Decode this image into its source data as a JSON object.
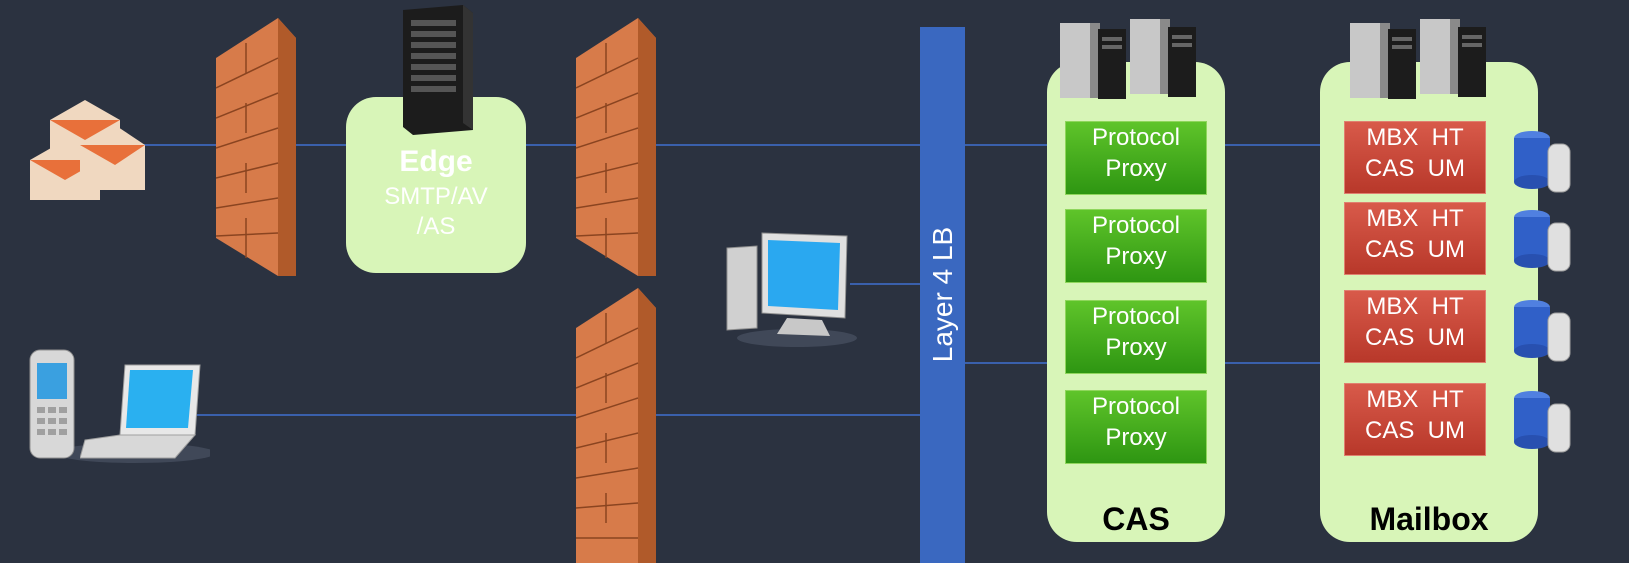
{
  "colors": {
    "background": "#2b3240",
    "panel": "#d8f5b8",
    "proxy": "#3fab1c",
    "mailbox_role": "#c8453a",
    "load_balancer": "#3a68c0",
    "connector": "#3f6fd0",
    "firewall": "#d77b4a"
  },
  "edge": {
    "title": "Edge",
    "line1": "SMTP/AV",
    "line2": "/AS"
  },
  "load_balancer": {
    "label": "Layer 4 LB"
  },
  "cas": {
    "title": "CAS",
    "proxies": [
      {
        "line1": "Protocol",
        "line2": "Proxy"
      },
      {
        "line1": "Protocol",
        "line2": "Proxy"
      },
      {
        "line1": "Protocol",
        "line2": "Proxy"
      },
      {
        "line1": "Protocol",
        "line2": "Proxy"
      }
    ]
  },
  "mailbox": {
    "title": "Mailbox",
    "roles": [
      {
        "line1": "MBX  HT",
        "line2": "CAS  UM"
      },
      {
        "line1": "MBX  HT",
        "line2": "CAS  UM"
      },
      {
        "line1": "MBX  HT",
        "line2": "CAS  UM"
      },
      {
        "line1": "MBX  HT",
        "line2": "CAS  UM"
      }
    ]
  },
  "icons": {
    "email": "email-envelopes-icon",
    "mobile": "mobile-phone-icon",
    "laptop": "laptop-icon",
    "desktop": "desktop-computer-icon",
    "server": "server-tower-icon",
    "database": "database-icon",
    "firewall": "firewall-icon"
  }
}
